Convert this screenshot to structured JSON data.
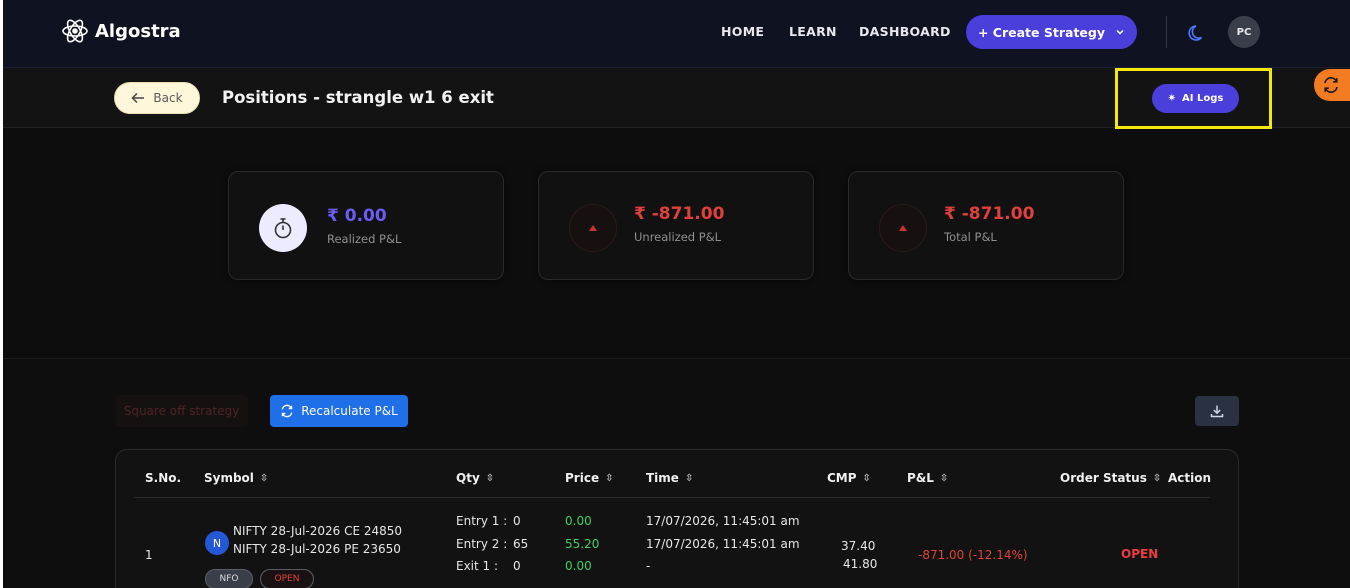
{
  "nav": {
    "brand": "Algostra",
    "links": [
      "HOME",
      "LEARN",
      "DASHBOARD"
    ],
    "create_label": "+ Create Strategy",
    "avatar_initials": "PC"
  },
  "header": {
    "back_label": "Back",
    "title": "Positions - strangle w1 6 exit",
    "ai_logs_label": "AI Logs"
  },
  "stats": [
    {
      "value": "₹ 0.00",
      "label": "Realized P&L"
    },
    {
      "value": "₹ -871.00",
      "label": "Unrealized P&L"
    },
    {
      "value": "₹ -871.00",
      "label": "Total P&L"
    }
  ],
  "controls": {
    "square_off_label": "Square off strategy",
    "recalc_label": "Recalculate P&L"
  },
  "table": {
    "headers": [
      "S.No.",
      "Symbol",
      "Qty",
      "Price",
      "Time",
      "CMP",
      "P&L",
      "Order Status",
      "Action"
    ],
    "row": {
      "sno": "1",
      "badge": "N",
      "symbols": [
        "NIFTY 28-Jul-2026 CE 24850",
        "NIFTY 28-Jul-2026 PE 23650"
      ],
      "tags": [
        "NFO",
        "OPEN"
      ],
      "qty_labels": [
        "Entry 1 :",
        "Entry 2 :",
        "Exit 1 :"
      ],
      "qty_values": [
        "0",
        "65",
        "0"
      ],
      "prices": [
        "0.00",
        "55.20",
        "0.00"
      ],
      "times": [
        "17/07/2026, 11:45:01 am",
        "17/07/2026, 11:45:01 am",
        "-"
      ],
      "cmp": [
        "37.40",
        "41.80"
      ],
      "pnl": "-871.00 (-12.14%)",
      "status": "OPEN"
    }
  },
  "colors": {
    "accent": "#4b3fdc",
    "highlight": "#f4e80c",
    "negative": "#e0403a",
    "positive": "#3bd163"
  }
}
